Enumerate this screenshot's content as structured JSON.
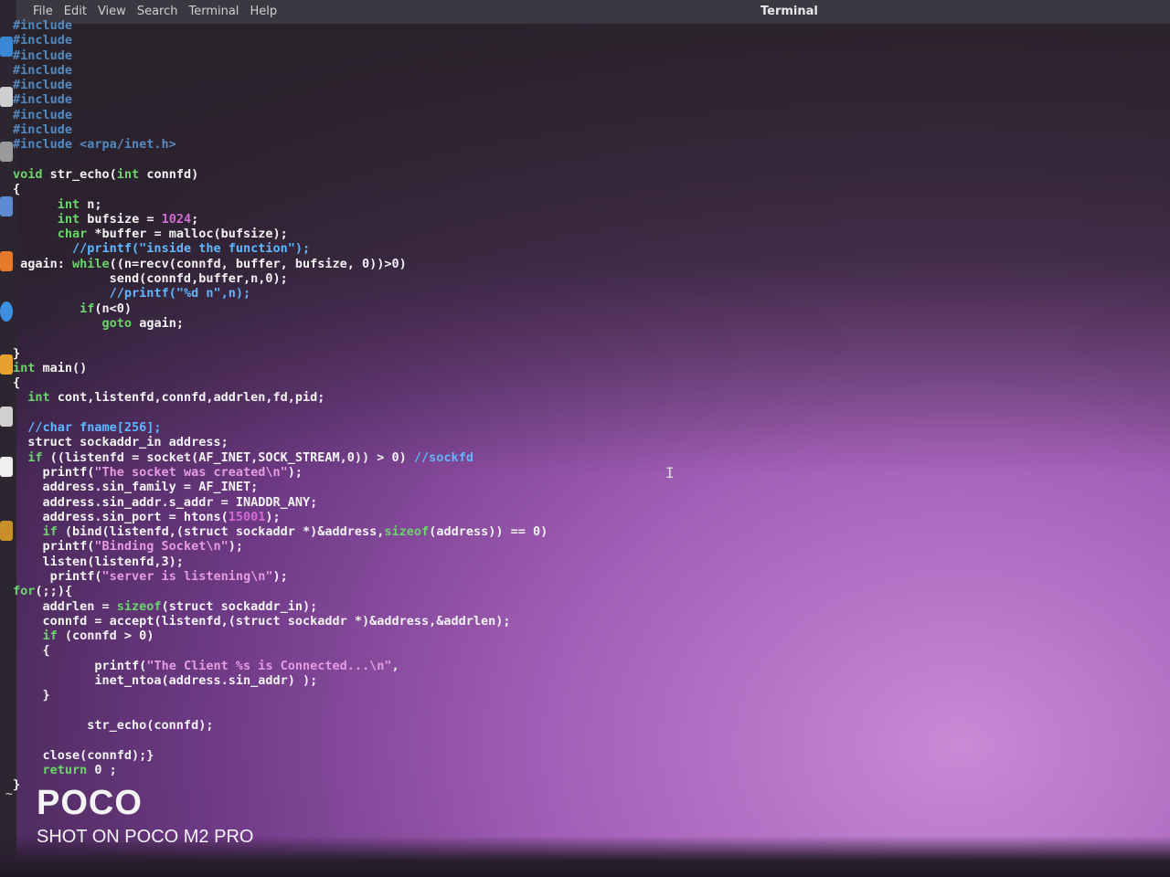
{
  "window": {
    "title": "Terminal",
    "menu": [
      "File",
      "Edit",
      "View",
      "Search",
      "Terminal",
      "Help"
    ]
  },
  "code_lines": [
    {
      "html": "<span class='inc'>#include</span>"
    },
    {
      "html": "<span class='inc'>#include</span>"
    },
    {
      "html": "<span class='inc'>#include</span>"
    },
    {
      "html": "<span class='inc'>#include</span>"
    },
    {
      "html": "<span class='inc'>#include</span>"
    },
    {
      "html": "<span class='inc'>#include</span>"
    },
    {
      "html": "<span class='inc'>#include</span>"
    },
    {
      "html": "<span class='inc'>#include</span>"
    },
    {
      "html": "<span class='inc'>#include &lt;arpa/inet.h&gt;</span>"
    },
    {
      "html": ""
    },
    {
      "html": "<span class='k'>void</span> str_echo(<span class='k'>int</span> connfd)"
    },
    {
      "html": "{"
    },
    {
      "html": "      <span class='ty'>int</span> n;"
    },
    {
      "html": "      <span class='ty'>int</span> bufsize = <span class='num'>1024</span>;"
    },
    {
      "html": "      <span class='ty'>char</span> *buffer = malloc(bufsize);"
    },
    {
      "html": "        <span class='com'>//printf(\"inside the function\");</span>"
    },
    {
      "html": " again: <span class='k'>while</span>((n=recv(connfd, buffer, bufsize, 0))&gt;0)"
    },
    {
      "html": "             send(connfd,buffer,n,0);"
    },
    {
      "html": "             <span class='com'>//printf(\"%d n\",n);</span>"
    },
    {
      "html": "         <span class='k'>if</span>(n&lt;0)"
    },
    {
      "html": "            <span class='k'>goto</span> again;"
    },
    {
      "html": ""
    },
    {
      "html": "}"
    },
    {
      "html": "<span class='ty'>int</span> main()"
    },
    {
      "html": "{"
    },
    {
      "html": "  <span class='ty'>int</span> cont,listenfd,connfd,addrlen,fd,pid;"
    },
    {
      "html": ""
    },
    {
      "html": "  <span class='com'>//char fname[256];</span>"
    },
    {
      "html": "  struct sockaddr_in address;"
    },
    {
      "html": "  <span class='k'>if</span> ((listenfd = socket(AF_INET,SOCK_STREAM,0)) &gt; 0) <span class='com'>//sockfd</span>"
    },
    {
      "html": "    printf(<span class='str'>\"The socket was created\\n\"</span>);"
    },
    {
      "html": "    address.sin_family = AF_INET;"
    },
    {
      "html": "    address.sin_addr.s_addr = INADDR_ANY;"
    },
    {
      "html": "    address.sin_port = htons(<span class='num'>15001</span>);"
    },
    {
      "html": "    <span class='k'>if</span> (bind(listenfd,(struct sockaddr *)&amp;address,<span class='k'>sizeof</span>(address)) == 0)"
    },
    {
      "html": "    printf(<span class='str'>\"Binding Socket\\n\"</span>);"
    },
    {
      "html": "    listen(listenfd,3);"
    },
    {
      "html": "     printf(<span class='str'>\"server is listening\\n\"</span>);"
    },
    {
      "html": "<span class='k'>for</span>(;;){"
    },
    {
      "html": "    addrlen = <span class='k'>sizeof</span>(struct sockaddr_in);"
    },
    {
      "html": "    connfd = accept(listenfd,(struct sockaddr *)&amp;address,&amp;addrlen);"
    },
    {
      "html": "    <span class='k'>if</span> (connfd &gt; 0)"
    },
    {
      "html": "    {"
    },
    {
      "html": "           printf(<span class='str'>\"The Client %s is Connected...\\n\"</span>,"
    },
    {
      "html": "           inet_ntoa(address.sin_addr) );"
    },
    {
      "html": "    }"
    },
    {
      "html": ""
    },
    {
      "html": "          str_echo(connfd);"
    },
    {
      "html": ""
    },
    {
      "html": "    close(connfd);}"
    },
    {
      "html": "    <span class='k'>return</span> 0 ;"
    },
    {
      "html": "}"
    }
  ],
  "watermark": {
    "brand": "POCO",
    "shot": "SHOT ON POCO M2 PRO"
  },
  "colors": {
    "keyword": "#6dd36d",
    "include": "#5fa3e4",
    "comment": "#5fb7ff",
    "string": "#e79be0",
    "number": "#d46ad4"
  }
}
